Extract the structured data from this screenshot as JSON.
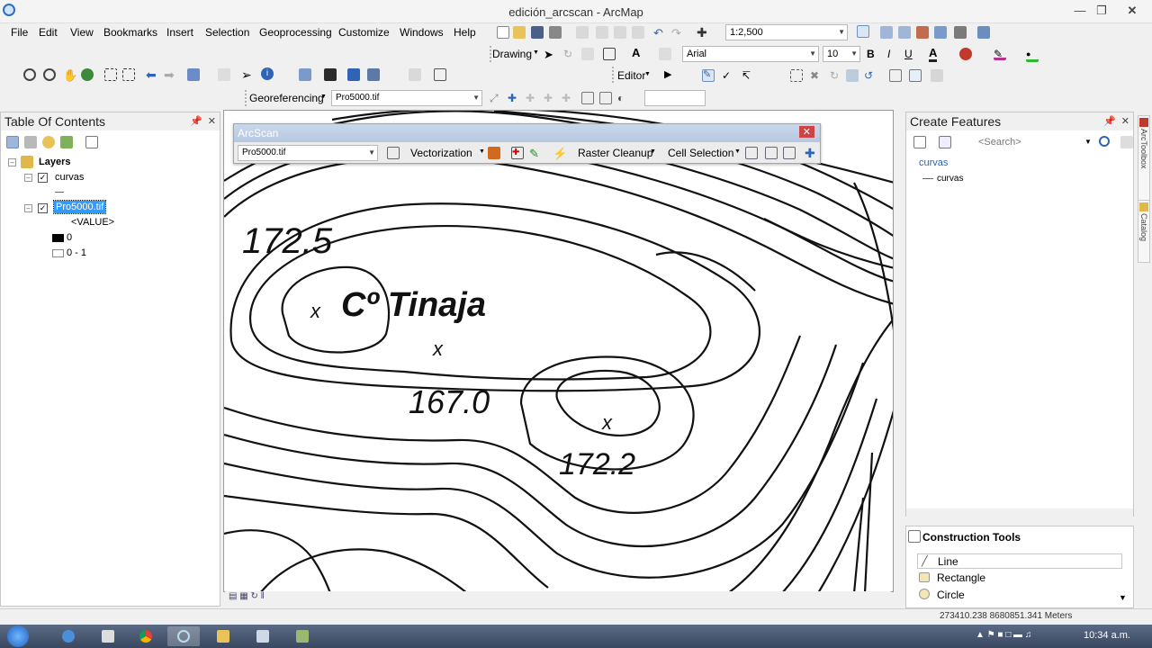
{
  "window": {
    "title": "edición_arcscan - ArcMap"
  },
  "menu": [
    "File",
    "Edit",
    "View",
    "Bookmarks",
    "Insert",
    "Selection",
    "Geoprocessing",
    "Customize",
    "Windows",
    "Help"
  ],
  "standard_toolbar": {
    "scale": "1:2,500"
  },
  "drawing_toolbar": {
    "label": "Drawing",
    "font": "Arial",
    "font_size": "10",
    "bold": "B",
    "italic": "I",
    "underline": "U"
  },
  "editor_toolbar": {
    "label": "Editor"
  },
  "georef_toolbar": {
    "label": "Georeferencing",
    "layer": "Pro5000.tif"
  },
  "toc": {
    "title": "Table Of Contents",
    "root": "Layers",
    "layers": [
      {
        "name": "curvas",
        "checked": true
      },
      {
        "name": "Pro5000.tif",
        "checked": true,
        "selected": true
      }
    ],
    "value_field": "<VALUE>",
    "legend": [
      {
        "label": "0",
        "color": "#000000"
      },
      {
        "label": "0 - 1",
        "color": "#ffffff"
      }
    ]
  },
  "map": {
    "labels": [
      "172.5",
      "Cº Tinaja",
      "167.0",
      "172.2"
    ],
    "point_marker": "x"
  },
  "arcscan": {
    "title": "ArcScan",
    "layer": "Pro5000.tif",
    "vectorization": "Vectorization",
    "raster_cleanup": "Raster Cleanup",
    "cell_selection": "Cell Selection"
  },
  "create_features": {
    "title": "Create Features",
    "search_placeholder": "<Search>",
    "group": "curvas",
    "templates": [
      "curvas"
    ]
  },
  "construction_tools": {
    "title": "Construction Tools",
    "tools": [
      "Line",
      "Rectangle",
      "Circle"
    ]
  },
  "side_tabs": [
    "ArcToolbox",
    "Catalog"
  ],
  "status": {
    "coords": "273410.238  8680851.341 Meters"
  },
  "taskbar": {
    "time": "10:34 a.m."
  }
}
